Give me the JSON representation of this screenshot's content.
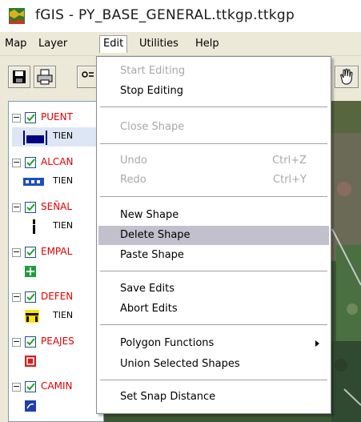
{
  "window": {
    "title": "fGIS - PY_BASE_GENERAL.ttkgp.ttkgp",
    "app_icon": "fgis-globe-icon"
  },
  "menubar": {
    "items": [
      {
        "label": "Map"
      },
      {
        "label": "Layer"
      },
      {
        "label": "Edit"
      },
      {
        "label": "Utilities"
      },
      {
        "label": "Help"
      }
    ],
    "active": "Edit"
  },
  "toolbar": {
    "buttons": [
      "save-icon",
      "print-icon",
      "add-layer-icon",
      "pan-hand-icon"
    ]
  },
  "toc": {
    "layers": [
      {
        "name": "PUENT",
        "sub": "TIEN",
        "symbol": "bridge-symbol",
        "checked": true,
        "expanded": true
      },
      {
        "name": "ALCAN",
        "sub": "TIEN",
        "symbol": "culvert-symbol",
        "checked": true,
        "expanded": true
      },
      {
        "name": "SEÑAL",
        "sub": "TIEN",
        "symbol": "sign-symbol",
        "checked": true,
        "expanded": true
      },
      {
        "name": "EMPAL",
        "sub": "",
        "symbol": "junction-symbol",
        "checked": true,
        "expanded": true
      },
      {
        "name": "DEFEN",
        "sub": "TIEN",
        "symbol": "guardrail-symbol",
        "checked": true,
        "expanded": true
      },
      {
        "name": "PEAJES",
        "sub": "",
        "symbol": "toll-symbol",
        "checked": true,
        "expanded": true
      },
      {
        "name": "CAMIN",
        "sub": "",
        "symbol": "road-symbol",
        "checked": true,
        "expanded": true
      }
    ]
  },
  "edit_menu": {
    "items": [
      {
        "label": "Start Editing",
        "enabled": false,
        "shortcut": ""
      },
      {
        "label": "Stop Editing",
        "enabled": true,
        "shortcut": ""
      },
      {
        "label": "Close Shape",
        "enabled": false,
        "shortcut": ""
      },
      {
        "label": "Undo",
        "enabled": false,
        "shortcut": "Ctrl+Z"
      },
      {
        "label": "Redo",
        "enabled": false,
        "shortcut": "Ctrl+Y"
      },
      {
        "label": "New Shape",
        "enabled": true,
        "shortcut": ""
      },
      {
        "label": "Delete Shape",
        "enabled": true,
        "shortcut": "",
        "highlighted": true
      },
      {
        "label": "Paste Shape",
        "enabled": true,
        "shortcut": ""
      },
      {
        "label": "Save Edits",
        "enabled": true,
        "shortcut": ""
      },
      {
        "label": "Abort Edits",
        "enabled": true,
        "shortcut": ""
      },
      {
        "label": "Polygon Functions",
        "enabled": true,
        "shortcut": "",
        "submenu": true
      },
      {
        "label": "Union Selected Shapes",
        "enabled": true,
        "shortcut": ""
      },
      {
        "label": "Set Snap Distance",
        "enabled": true,
        "shortcut": ""
      }
    ]
  },
  "colors": {
    "layer_name": "#e00000",
    "menu_highlight": "#c1c0cc",
    "disabled_text": "#a8a8a8",
    "chrome": "#ece9d8"
  }
}
